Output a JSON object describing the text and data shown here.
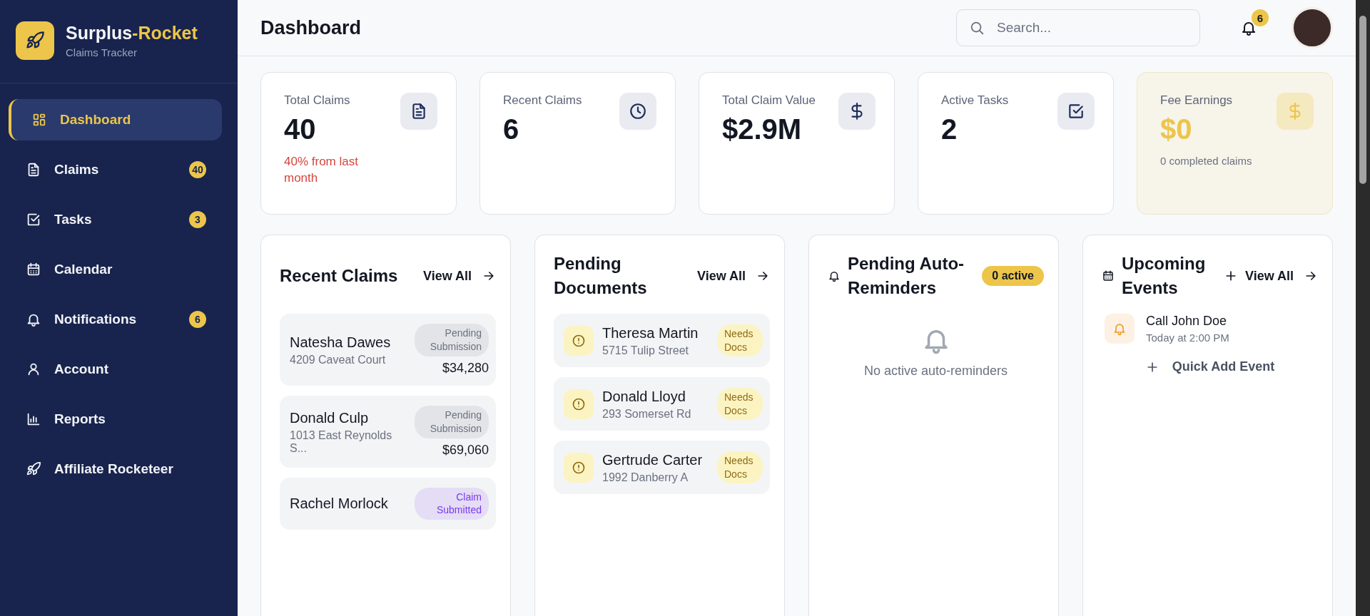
{
  "sidebar": {
    "brand": {
      "name_first": "Surplus",
      "name_second": "-Rocket",
      "subtitle": "Claims Tracker"
    },
    "items": [
      {
        "label": "Dashboard",
        "selected": true
      },
      {
        "label": "Claims",
        "selected": false,
        "badge": "40"
      },
      {
        "label": "Tasks",
        "selected": false,
        "badge": "3"
      },
      {
        "label": "Calendar",
        "selected": false
      },
      {
        "label": "Notifications",
        "selected": false,
        "badge": "6"
      },
      {
        "label": "Account",
        "selected": false
      },
      {
        "label": "Reports",
        "selected": false
      },
      {
        "label": "Affiliate Rocketeer",
        "selected": false
      }
    ]
  },
  "header": {
    "title": "Dashboard",
    "search": {
      "placeholder": "Search..."
    },
    "notification_count": "6"
  },
  "stats": [
    {
      "kind": "standard",
      "label": "Total Claims",
      "value": "40",
      "note": "40% from last month"
    },
    {
      "kind": "standard",
      "label": "Recent Claims",
      "value": "6"
    },
    {
      "kind": "standard",
      "label": "Total Claim Value",
      "value": "$2.9M"
    },
    {
      "kind": "standard",
      "label": "Active Tasks",
      "value": "2"
    },
    {
      "kind": "accent",
      "label": "Fee Earnings",
      "value": "$0",
      "note": "0 completed claims"
    }
  ],
  "recent_claims": {
    "title": "Recent Claims",
    "view_all": "View All",
    "items": [
      {
        "name": "Natesha Dawes",
        "address": "4209 Caveat Court",
        "status": "Pending Submission",
        "color": "#6b7280",
        "amount": "$34,280"
      },
      {
        "name": "Donald Culp",
        "address": "1013 East Reynolds S...",
        "status": "Pending Submission",
        "color": "#6b7280",
        "amount": "$69,060"
      },
      {
        "name": "Rachel Morlock",
        "status": "Claim Submitted",
        "color": "#7c3aed"
      }
    ]
  },
  "pending_documents": {
    "title": "Pending Documents",
    "view_all": "View All",
    "items": [
      {
        "name": "Theresa Martin",
        "address": "5715 Tulip Street",
        "status": "Needs Docs"
      },
      {
        "name": "Donald Lloyd",
        "address": "293 Somerset Rd",
        "status": "Needs Docs"
      },
      {
        "name": "Gertrude Carter",
        "address": "1992 Danberry A",
        "status": "Needs Docs"
      }
    ]
  },
  "auto_reminders": {
    "title": "Pending Auto-Reminders",
    "badge": "0 active",
    "empty_text": "No active auto-reminders"
  },
  "upcoming_events": {
    "title": "Upcoming Events",
    "view_all": "View All",
    "events": [
      {
        "title": "Call John Doe",
        "time": "Today at 2:00 PM"
      }
    ],
    "quick_add": "Quick Add Event"
  }
}
